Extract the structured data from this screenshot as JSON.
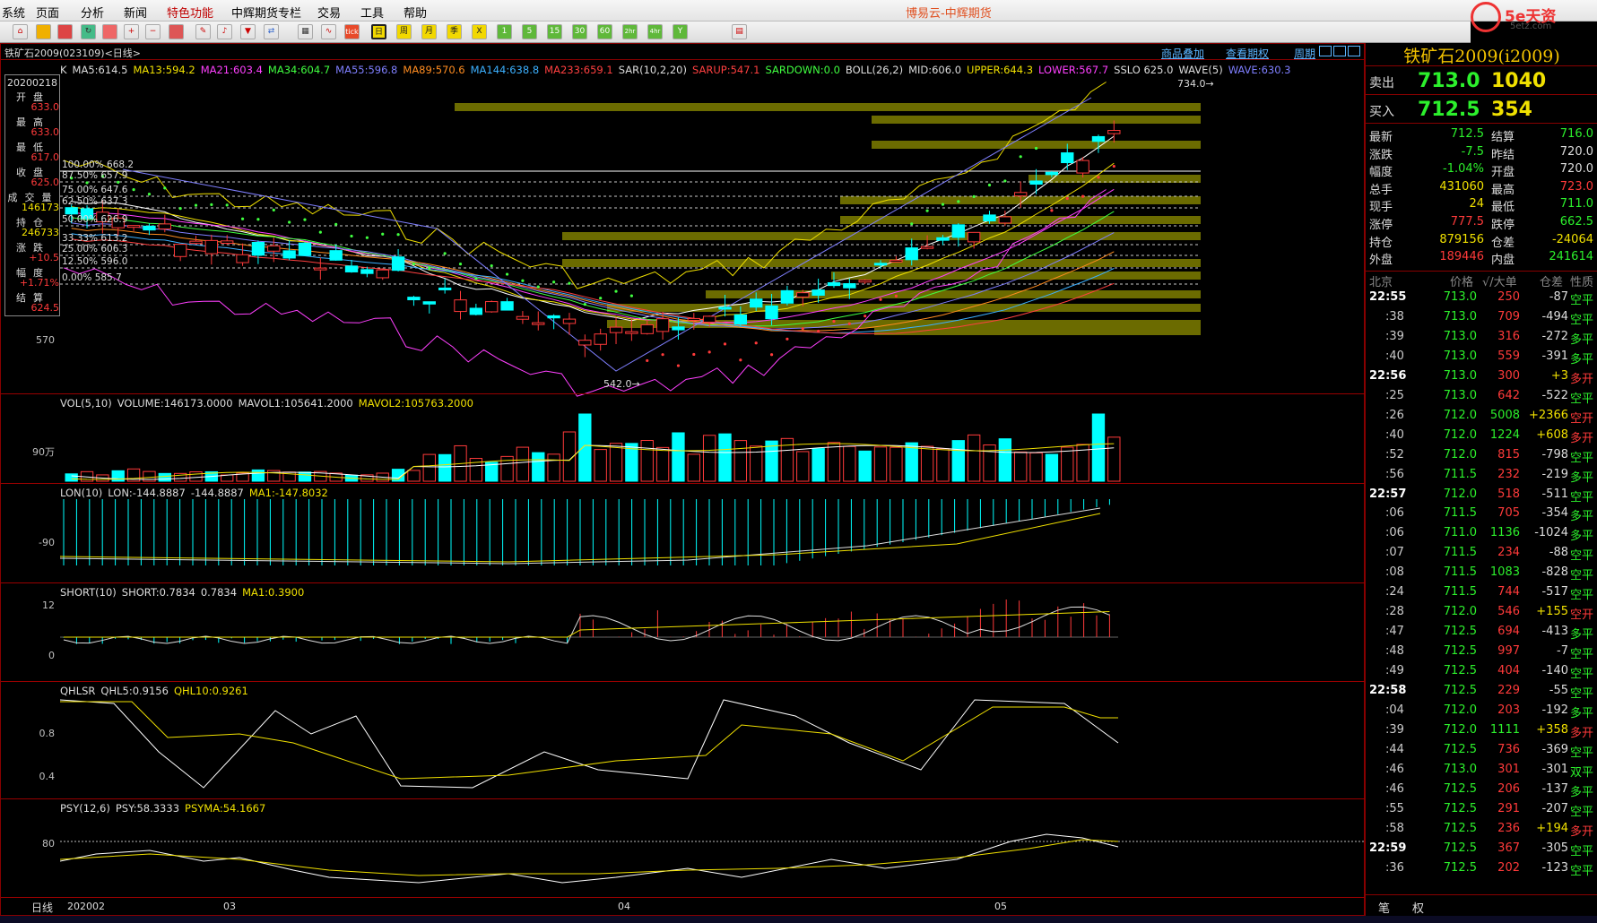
{
  "menu": {
    "items": [
      "系统",
      "页面",
      "分析",
      "新闻",
      "特色功能",
      "中辉期货专栏",
      "交易",
      "工具",
      "帮助"
    ],
    "highlight": "特色功能",
    "app_title": "博易云-中辉期货"
  },
  "logo": {
    "main": "5e天资",
    "sub": "5etz.com"
  },
  "toolbar": {
    "period_buttons": [
      "日",
      "周",
      "月",
      "季",
      "X",
      "1",
      "5",
      "15",
      "30",
      "60",
      "2hr",
      "4hr",
      "Y"
    ],
    "tick_button": "tick"
  },
  "chart": {
    "symbol": "铁矿石2009(023109)<日线>",
    "links": [
      "商品叠加",
      "查看期权",
      "周期"
    ],
    "main_indicator": [
      {
        "text": "K",
        "color": "#dddddd"
      },
      {
        "text": "MA5:614.5",
        "color": "#dddddd"
      },
      {
        "text": "MA13:594.2",
        "color": "#f0e000"
      },
      {
        "text": "MA21:603.4",
        "color": "#ff40ff"
      },
      {
        "text": "MA34:604.7",
        "color": "#40ff40"
      },
      {
        "text": "MA55:596.8",
        "color": "#7f7fff"
      },
      {
        "text": "MA89:570.6",
        "color": "#ff8c20"
      },
      {
        "text": "MA144:638.8",
        "color": "#3cb0ff"
      },
      {
        "text": "MA233:659.1",
        "color": "#ff4040"
      },
      {
        "text": "SAR(10,2,20)",
        "color": "#dddddd"
      },
      {
        "text": "SARUP:547.1",
        "color": "#ff4040"
      },
      {
        "text": "SARDOWN:0.0",
        "color": "#40ff40"
      },
      {
        "text": "BOLL(26,2)",
        "color": "#dddddd"
      },
      {
        "text": "MID:606.0",
        "color": "#dddddd"
      },
      {
        "text": "UPPER:644.3",
        "color": "#f0e000"
      },
      {
        "text": "LOWER:567.7",
        "color": "#ff40ff"
      },
      {
        "text": "SSLO 625.0",
        "color": "#dddddd"
      },
      {
        "text": "WAVE(5)",
        "color": "#dddddd"
      },
      {
        "text": "WAVE:630.3",
        "color": "#7f7fff"
      }
    ],
    "ohlc_box": {
      "date": "20200218",
      "rows": [
        {
          "label": "开盘",
          "value": "633.0",
          "color": "#ff3a3a"
        },
        {
          "label": "最高",
          "value": "633.0",
          "color": "#ff3a3a"
        },
        {
          "label": "最低",
          "value": "617.0",
          "color": "#ff3a3a"
        },
        {
          "label": "收盘",
          "value": "625.0",
          "color": "#ff3a3a"
        },
        {
          "label": "成交量",
          "value": "146173",
          "color": "#f0e000"
        },
        {
          "label": "持仓",
          "value": "246733",
          "color": "#f0e000"
        },
        {
          "label": "涨跌",
          "value": "+10.5",
          "color": "#ff3a3a"
        },
        {
          "label": "幅度",
          "value": "+1.71%",
          "color": "#ff3a3a"
        },
        {
          "label": "结算",
          "value": "624.5",
          "color": "#ff3a3a"
        }
      ]
    },
    "fib_levels": [
      "100.00% 668.2",
      "87.50% 657.9",
      "75.00% 647.6",
      "62.50% 637.3",
      "50.00% 626.9",
      "33.33% 613.2",
      "25.00% 606.3",
      "12.50% 596.0",
      "0.00% 585.7"
    ],
    "price_axis_label": "570",
    "high_mark": "734.0→",
    "low_mark": "542.0→",
    "volume_indicator": [
      {
        "text": "VOL(5,10)",
        "color": "#dddddd"
      },
      {
        "text": "VOLUME:146173.0000",
        "color": "#dddddd"
      },
      {
        "text": "MAVOL1:105641.2000",
        "color": "#dddddd"
      },
      {
        "text": "MAVOL2:105763.2000",
        "color": "#f0e000"
      }
    ],
    "volume_axis": "90万",
    "lon_indicator": [
      {
        "text": "LON(10)",
        "color": "#dddddd"
      },
      {
        "text": "LON:-144.8887",
        "color": "#dddddd"
      },
      {
        "text": "-144.8887",
        "color": "#dddddd"
      },
      {
        "text": "MA1:-147.8032",
        "color": "#f0e000"
      }
    ],
    "lon_axis": "-90",
    "short_indicator": [
      {
        "text": "SHORT(10)",
        "color": "#dddddd"
      },
      {
        "text": "SHORT:0.7834",
        "color": "#dddddd"
      },
      {
        "text": "0.7834",
        "color": "#dddddd"
      },
      {
        "text": "MA1:0.3900",
        "color": "#f0e000"
      }
    ],
    "short_axis": [
      "12",
      "0"
    ],
    "qhlsr_indicator": [
      {
        "text": "QHLSR",
        "color": "#dddddd"
      },
      {
        "text": "QHL5:0.9156",
        "color": "#dddddd"
      },
      {
        "text": "QHL10:0.9261",
        "color": "#f0e000"
      }
    ],
    "qhlsr_axis": [
      "0.8",
      "0.4"
    ],
    "psy_indicator": [
      {
        "text": "PSY(12,6)",
        "color": "#dddddd"
      },
      {
        "text": "PSY:58.3333",
        "color": "#dddddd"
      },
      {
        "text": "PSYMA:54.1667",
        "color": "#f0e000"
      }
    ],
    "psy_axis": "80",
    "period_label": "日线",
    "date_axis": [
      "202002",
      "03",
      "04",
      "05"
    ]
  },
  "quote": {
    "title": "铁矿石2009(i2009)",
    "ask": {
      "label": "卖出",
      "price": "713.0",
      "volume": "1040"
    },
    "bid": {
      "label": "买入",
      "price": "712.5",
      "volume": "354"
    },
    "rows": [
      {
        "l1": "最新",
        "v1": "712.5",
        "c1": "#2cf02c",
        "l2": "结算",
        "v2": "716.0",
        "c2": "#2cf02c"
      },
      {
        "l1": "涨跌",
        "v1": "-7.5",
        "c1": "#2cf02c",
        "l2": "昨结",
        "v2": "720.0",
        "c2": "#dddddd"
      },
      {
        "l1": "幅度",
        "v1": "-1.04%",
        "c1": "#2cf02c",
        "l2": "开盘",
        "v2": "720.0",
        "c2": "#dddddd"
      },
      {
        "l1": "总手",
        "v1": "431060",
        "c1": "#f0e000",
        "l2": "最高",
        "v2": "723.0",
        "c2": "#ff3a3a"
      },
      {
        "l1": "现手",
        "v1": "24",
        "c1": "#f0e000",
        "l2": "最低",
        "v2": "711.0",
        "c2": "#2cf02c"
      },
      {
        "l1": "涨停",
        "v1": "777.5",
        "c1": "#ff3a3a",
        "l2": "跌停",
        "v2": "662.5",
        "c2": "#2cf02c"
      },
      {
        "l1": "持仓",
        "v1": "879156",
        "c1": "#f0e000",
        "l2": "仓差",
        "v2": "-24064",
        "c2": "#f0e000"
      },
      {
        "l1": "外盘",
        "v1": "189446",
        "c1": "#ff3a3a",
        "l2": "内盘",
        "v2": "241614",
        "c2": "#2cf02c"
      }
    ],
    "tick_header": {
      "time": "北京",
      "price": "价格",
      "qty": "√/大单",
      "oi": "仓差",
      "nature": "性质"
    },
    "ticks": [
      {
        "time": "22:55",
        "price": "713.0",
        "qty": "250",
        "oi": "-87",
        "nature": "空平",
        "full": true
      },
      {
        "time": ":38",
        "price": "713.0",
        "qty": "709",
        "oi": "-494",
        "nature": "空平"
      },
      {
        "time": ":39",
        "price": "713.0",
        "qty": "316",
        "oi": "-272",
        "nature": "多平"
      },
      {
        "time": ":40",
        "price": "713.0",
        "qty": "559",
        "oi": "-391",
        "nature": "多平"
      },
      {
        "time": "22:56",
        "price": "713.0",
        "qty": "300",
        "oi": "+3",
        "nature": "多开",
        "full": true
      },
      {
        "time": ":25",
        "price": "713.0",
        "qty": "642",
        "oi": "-522",
        "nature": "空平"
      },
      {
        "time": ":26",
        "price": "712.0",
        "qty": "5008",
        "oi": "+2366",
        "nature": "空开"
      },
      {
        "time": ":40",
        "price": "712.0",
        "qty": "1224",
        "oi": "+608",
        "nature": "多开"
      },
      {
        "time": ":52",
        "price": "712.0",
        "qty": "815",
        "oi": "-798",
        "nature": "空平"
      },
      {
        "time": ":56",
        "price": "711.5",
        "qty": "232",
        "oi": "-219",
        "nature": "多平"
      },
      {
        "time": "22:57",
        "price": "712.0",
        "qty": "518",
        "oi": "-511",
        "nature": "空平",
        "full": true
      },
      {
        "time": ":06",
        "price": "711.5",
        "qty": "705",
        "oi": "-354",
        "nature": "多平"
      },
      {
        "time": ":06",
        "price": "711.0",
        "qty": "1136",
        "oi": "-1024",
        "nature": "多平"
      },
      {
        "time": ":07",
        "price": "711.5",
        "qty": "234",
        "oi": "-88",
        "nature": "空平"
      },
      {
        "time": ":08",
        "price": "711.5",
        "qty": "1083",
        "oi": "-828",
        "nature": "空平"
      },
      {
        "time": ":24",
        "price": "711.5",
        "qty": "744",
        "oi": "-517",
        "nature": "空平"
      },
      {
        "time": ":28",
        "price": "712.0",
        "qty": "546",
        "oi": "+155",
        "nature": "空开"
      },
      {
        "time": ":47",
        "price": "712.5",
        "qty": "694",
        "oi": "-413",
        "nature": "多平"
      },
      {
        "time": ":48",
        "price": "712.5",
        "qty": "997",
        "oi": "-7",
        "nature": "空平"
      },
      {
        "time": ":49",
        "price": "712.5",
        "qty": "404",
        "oi": "-140",
        "nature": "空平"
      },
      {
        "time": "22:58",
        "price": "712.5",
        "qty": "229",
        "oi": "-55",
        "nature": "空平",
        "full": true
      },
      {
        "time": ":04",
        "price": "712.0",
        "qty": "203",
        "oi": "-192",
        "nature": "多平"
      },
      {
        "time": ":39",
        "price": "712.0",
        "qty": "1111",
        "oi": "+358",
        "nature": "多开"
      },
      {
        "time": ":44",
        "price": "712.5",
        "qty": "736",
        "oi": "-369",
        "nature": "空平"
      },
      {
        "time": ":46",
        "price": "713.0",
        "qty": "301",
        "oi": "-301",
        "nature": "双平"
      },
      {
        "time": ":46",
        "price": "712.5",
        "qty": "206",
        "oi": "-137",
        "nature": "多平"
      },
      {
        "time": ":55",
        "price": "712.5",
        "qty": "291",
        "oi": "-207",
        "nature": "空平"
      },
      {
        "time": ":58",
        "price": "712.5",
        "qty": "236",
        "oi": "+194",
        "nature": "多开"
      },
      {
        "time": "22:59",
        "price": "712.5",
        "qty": "367",
        "oi": "-305",
        "nature": "空平",
        "full": true
      },
      {
        "time": ":36",
        "price": "712.5",
        "qty": "202",
        "oi": "-123",
        "nature": "空平"
      }
    ],
    "tabs": [
      "笔",
      "权"
    ]
  },
  "colors": {
    "up": "#ff3a3a",
    "down": "#00ffff",
    "panel_border": "#990000",
    "accent_yellow": "#f0e000"
  }
}
